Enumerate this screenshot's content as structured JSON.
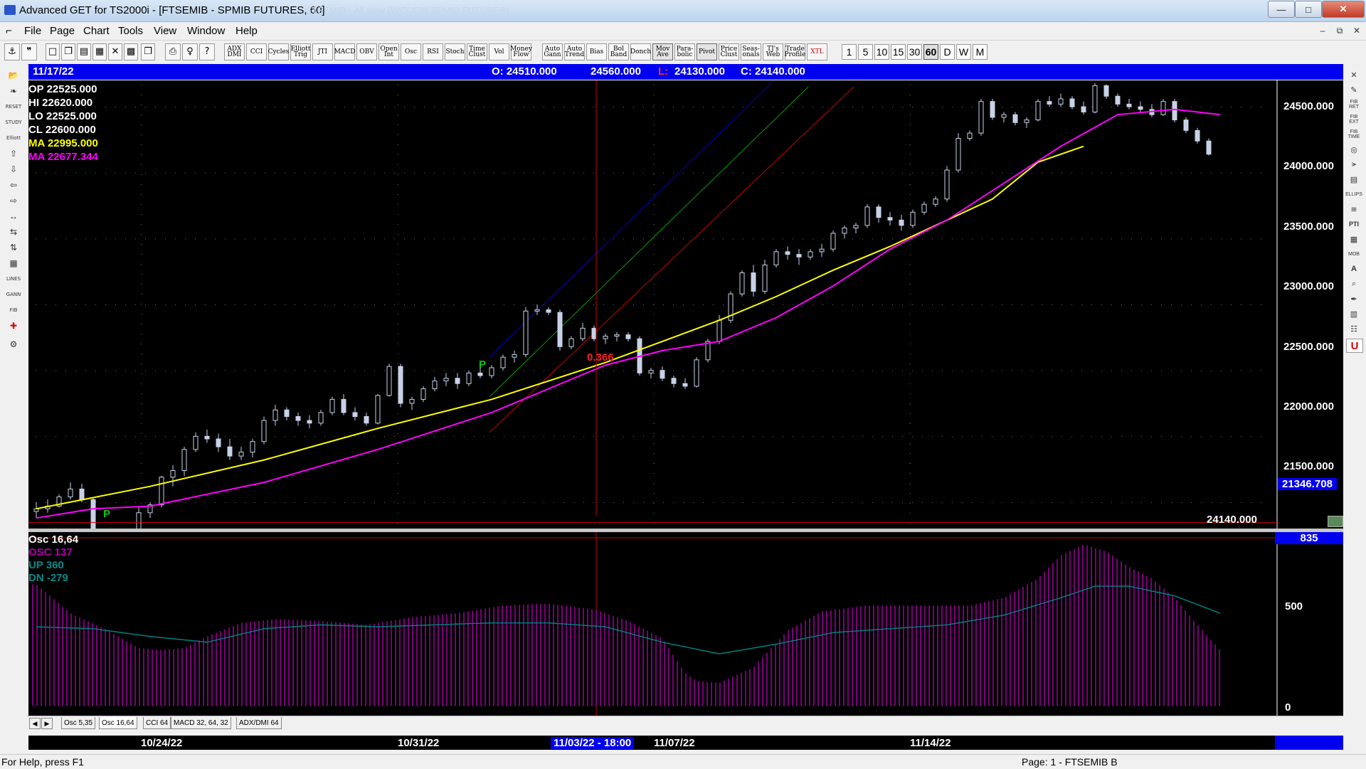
{
  "window": {
    "title": "Advanced GET for TS2000i - [FTSEMIB - SPMIB FUTURES, 60]",
    "ghost_title": "FTSEMIB - All view (WCCCW SPMIB FUTURES)",
    "minimize": "—",
    "maximize": "□",
    "close": "✕"
  },
  "menu": {
    "items": [
      "File",
      "Page",
      "Chart",
      "Tools",
      "View",
      "Window",
      "Help"
    ],
    "mdi_minimize": "–",
    "mdi_restore": "⧉",
    "mdi_close": "✕"
  },
  "toolbar": {
    "icons": [
      "thumbtack-icon",
      "quote-icon",
      "new-page-icon",
      "copy-page-icon",
      "layout-icon",
      "tile-icon",
      "zoom-icon",
      "grid-icon",
      "export-icon",
      "print-icon",
      "help-icon",
      "context-help-icon"
    ],
    "study_buttons": [
      "ADX DMI",
      "CCI",
      "Cycles",
      "Elliott Trig",
      "JTI",
      "MACD",
      "OBV",
      "Open Int",
      "Osc",
      "RSI",
      "Stoch",
      "Time Clust",
      "Vol",
      "Money Flow",
      "Auto Gann",
      "Auto Trend",
      "Bias",
      "Bol Band",
      "Donch",
      "Mov Ave",
      "Para- bolic",
      "Pivot",
      "Price Clust",
      "Seas- onals",
      "TJ's Web",
      "Trade Profile",
      "XTL"
    ],
    "timeframes": [
      "1",
      "5",
      "10",
      "15",
      "30",
      "60",
      "D",
      "W",
      "M"
    ],
    "selected_timeframe": "60"
  },
  "left_tools": [
    "open-icon",
    "pattern-icon",
    "reset",
    "study",
    "elliott",
    "arrow-up-icon",
    "arrow-down-icon",
    "arrow-left-icon",
    "arrow-right-icon",
    "zoom-h-icon",
    "scroll-h-icon",
    "scroll-v-icon",
    "grid",
    "lines",
    "gann",
    "fib",
    "crosshair-icon",
    "settings-icon"
  ],
  "left_tool_labels": {
    "reset": "RESET",
    "study": "STUDY",
    "elliott": "Elliott",
    "lines": "LINES",
    "gann": "GANN",
    "fib": "FIB"
  },
  "right_tools": [
    "close-icon",
    "pencil-icon",
    "fib-ret",
    "fib-ext",
    "fib-time",
    "circle-icon",
    "fan-icon",
    "box-icon",
    "ellipse",
    "wave-icon",
    "pti",
    "grid-icon",
    "mob",
    "text-icon",
    "magnify-icon",
    "marker-icon",
    "table-icon",
    "notes-icon",
    "u-icon"
  ],
  "right_tool_labels": {
    "fib-ret": "FIB RET",
    "fib-ext": "FIB EXT",
    "fib-time": "FIB TIME",
    "ellipse": "ELLIPS",
    "pti": "PTI",
    "mob": "MOB"
  },
  "info_bar": {
    "date": "11/17/22",
    "open": "O: 24510.000",
    "high": "24560.000",
    "low_prefix": "L:",
    "low": "24130.000",
    "close": "C: 24140.000"
  },
  "price_legend": {
    "op": "OP  22525.000",
    "hi": "HI   22620.000",
    "lo": "LO  22525.000",
    "cl": "CL  22600.000",
    "ma1": "MA  22995.000",
    "ma2": "MA  22677.344"
  },
  "price_axis": {
    "ticks": [
      "24500.000",
      "24000.000",
      "23500.000",
      "23000.000",
      "22500.000",
      "22000.000",
      "21500.000"
    ],
    "cursor_price": "21346.708",
    "last_price": "24140.000"
  },
  "annotations": {
    "pivot_label": "P",
    "pivot_value": "0.366"
  },
  "osc_legend": {
    "title": "Osc 16,64",
    "osc": "OSC 137",
    "up": "UP   360",
    "dn": "DN   -279"
  },
  "osc_axis": {
    "ticks": [
      "500",
      "0"
    ],
    "top_value": "835"
  },
  "tabs": [
    "Osc 5,35",
    "Osc 16,64",
    "CCI 64",
    "MACD 32, 64, 32",
    "ADX/DMI 64"
  ],
  "active_tab": "Osc 16,64",
  "dates": {
    "labels": [
      "10/24/22",
      "10/31/22",
      "11/07/22",
      "11/14/22"
    ],
    "cursor": "11/03/22 - 18:00"
  },
  "status": {
    "help": "For Help, press F1",
    "page": "Page: 1 - FTSEMIB B"
  },
  "colors": {
    "background": "#000000",
    "candle": "#c8d2e6",
    "ma_fast": "#ffff00",
    "ma_slow": "#ff00ff",
    "channel_blue": "#0000cc",
    "channel_green": "#00a000",
    "channel_red": "#cc0000",
    "osc_bars": "#cc00cc",
    "osc_line": "#008080",
    "info_bar": "#0000ee"
  },
  "chart_data": {
    "type": "candlestick",
    "symbol": "FTSEMIB - SPMIB FUTURES",
    "interval": "60",
    "ylim": [
      21300,
      24700
    ],
    "grid": true,
    "candles": [
      [
        21430,
        21500,
        21380,
        21450
      ],
      [
        21450,
        21520,
        21420,
        21470
      ],
      [
        21470,
        21560,
        21460,
        21540
      ],
      [
        21540,
        21650,
        21520,
        21600
      ],
      [
        21600,
        21640,
        21500,
        21520
      ],
      [
        21520,
        21530,
        21180,
        21220
      ],
      [
        21220,
        21280,
        21150,
        21240
      ],
      [
        21240,
        21300,
        21180,
        21220
      ],
      [
        21220,
        21260,
        21120,
        21160
      ],
      [
        21160,
        21460,
        21140,
        21420
      ],
      [
        21420,
        21500,
        21380,
        21480
      ],
      [
        21480,
        21700,
        21460,
        21690
      ],
      [
        21690,
        21780,
        21620,
        21740
      ],
      [
        21740,
        21920,
        21700,
        21900
      ],
      [
        21900,
        22030,
        21880,
        22000
      ],
      [
        22000,
        22050,
        21950,
        21980
      ],
      [
        21980,
        22020,
        21880,
        21920
      ],
      [
        21920,
        21980,
        21820,
        21850
      ],
      [
        21850,
        21920,
        21820,
        21880
      ],
      [
        21880,
        21980,
        21840,
        21960
      ],
      [
        21960,
        22150,
        21940,
        22120
      ],
      [
        22120,
        22240,
        22080,
        22200
      ],
      [
        22200,
        22220,
        22120,
        22150
      ],
      [
        22150,
        22180,
        22080,
        22120
      ],
      [
        22120,
        22160,
        22060,
        22100
      ],
      [
        22100,
        22200,
        22080,
        22180
      ],
      [
        22180,
        22300,
        22160,
        22280
      ],
      [
        22280,
        22320,
        22160,
        22180
      ],
      [
        22180,
        22220,
        22120,
        22150
      ],
      [
        22150,
        22180,
        22080,
        22100
      ],
      [
        22100,
        22320,
        22090,
        22310
      ],
      [
        22310,
        22550,
        22300,
        22530
      ],
      [
        22530,
        22550,
        22220,
        22250
      ],
      [
        22250,
        22300,
        22200,
        22280
      ],
      [
        22280,
        22380,
        22260,
        22360
      ],
      [
        22360,
        22450,
        22340,
        22420
      ],
      [
        22420,
        22480,
        22380,
        22440
      ],
      [
        22440,
        22480,
        22360,
        22400
      ],
      [
        22400,
        22500,
        22380,
        22480
      ],
      [
        22480,
        22520,
        22440,
        22460
      ],
      [
        22460,
        22540,
        22440,
        22520
      ],
      [
        22520,
        22620,
        22500,
        22600
      ],
      [
        22600,
        22650,
        22560,
        22620
      ],
      [
        22620,
        22980,
        22600,
        22950
      ],
      [
        22950,
        23000,
        22920,
        22960
      ],
      [
        22960,
        22980,
        22920,
        22940
      ],
      [
        22940,
        22960,
        22650,
        22680
      ],
      [
        22680,
        22760,
        22660,
        22740
      ],
      [
        22740,
        22860,
        22720,
        22820
      ],
      [
        22820,
        22840,
        22720,
        22740
      ],
      [
        22740,
        22780,
        22700,
        22760
      ],
      [
        22760,
        22790,
        22720,
        22770
      ],
      [
        22770,
        22790,
        22720,
        22740
      ],
      [
        22740,
        22760,
        22460,
        22480
      ],
      [
        22480,
        22520,
        22440,
        22500
      ],
      [
        22500,
        22530,
        22420,
        22440
      ],
      [
        22440,
        22460,
        22370,
        22400
      ],
      [
        22400,
        22440,
        22360,
        22380
      ],
      [
        22380,
        22600,
        22370,
        22580
      ],
      [
        22580,
        22740,
        22560,
        22720
      ],
      [
        22720,
        22920,
        22700,
        22880
      ],
      [
        22880,
        23100,
        22860,
        23080
      ],
      [
        23080,
        23260,
        23060,
        23240
      ],
      [
        23240,
        23300,
        23060,
        23100
      ],
      [
        23100,
        23340,
        23080,
        23300
      ],
      [
        23300,
        23420,
        23280,
        23400
      ],
      [
        23400,
        23440,
        23340,
        23380
      ],
      [
        23380,
        23420,
        23300,
        23360
      ],
      [
        23360,
        23420,
        23340,
        23400
      ],
      [
        23400,
        23460,
        23360,
        23420
      ],
      [
        23420,
        23560,
        23400,
        23540
      ],
      [
        23540,
        23600,
        23500,
        23580
      ],
      [
        23580,
        23620,
        23540,
        23600
      ],
      [
        23600,
        23760,
        23580,
        23740
      ],
      [
        23740,
        23760,
        23620,
        23660
      ],
      [
        23660,
        23700,
        23600,
        23640
      ],
      [
        23640,
        23680,
        23560,
        23600
      ],
      [
        23600,
        23720,
        23580,
        23700
      ],
      [
        23700,
        23780,
        23680,
        23760
      ],
      [
        23760,
        23820,
        23740,
        23800
      ],
      [
        23800,
        24050,
        23780,
        24020
      ],
      [
        24020,
        24300,
        24000,
        24260
      ],
      [
        24260,
        24320,
        24240,
        24300
      ],
      [
        24300,
        24560,
        24280,
        24540
      ],
      [
        24540,
        24560,
        24400,
        24420
      ],
      [
        24420,
        24460,
        24380,
        24440
      ],
      [
        24440,
        24460,
        24360,
        24380
      ],
      [
        24380,
        24420,
        24340,
        24400
      ],
      [
        24400,
        24560,
        24390,
        24540
      ],
      [
        24540,
        24580,
        24500,
        24520
      ],
      [
        24520,
        24600,
        24500,
        24560
      ],
      [
        24560,
        24580,
        24480,
        24500
      ],
      [
        24500,
        24540,
        24440,
        24460
      ],
      [
        24460,
        24680,
        24450,
        24660
      ],
      [
        24660,
        24670,
        24560,
        24580
      ],
      [
        24580,
        24600,
        24500,
        24520
      ],
      [
        24520,
        24560,
        24480,
        24500
      ],
      [
        24500,
        24540,
        24460,
        24480
      ],
      [
        24480,
        24520,
        24420,
        24440
      ],
      [
        24440,
        24560,
        24430,
        24540
      ],
      [
        24540,
        24560,
        24380,
        24400
      ],
      [
        24400,
        24420,
        24300,
        24320
      ],
      [
        24320,
        24340,
        24220,
        24240
      ],
      [
        24240,
        24260,
        24130,
        24140
      ]
    ],
    "ma_fast": [
      [
        0,
        21450
      ],
      [
        10,
        21620
      ],
      [
        20,
        21820
      ],
      [
        30,
        22060
      ],
      [
        40,
        22280
      ],
      [
        50,
        22560
      ],
      [
        55,
        22720
      ],
      [
        60,
        22880
      ],
      [
        65,
        23060
      ],
      [
        70,
        23260
      ],
      [
        75,
        23440
      ],
      [
        80,
        23640
      ],
      [
        84,
        23800
      ],
      [
        88,
        24080
      ],
      [
        92,
        24200
      ]
    ],
    "ma_slow": [
      [
        0,
        21380
      ],
      [
        5,
        21450
      ],
      [
        10,
        21470
      ],
      [
        20,
        21650
      ],
      [
        30,
        21900
      ],
      [
        40,
        22180
      ],
      [
        50,
        22540
      ],
      [
        55,
        22650
      ],
      [
        60,
        22720
      ],
      [
        65,
        22900
      ],
      [
        70,
        23140
      ],
      [
        75,
        23420
      ],
      [
        80,
        23640
      ],
      [
        85,
        23920
      ],
      [
        90,
        24200
      ],
      [
        95,
        24440
      ],
      [
        100,
        24480
      ],
      [
        104,
        24440
      ]
    ],
    "oscillator": {
      "name": "Osc 16,64",
      "ylim": [
        -50,
        900
      ],
      "histogram": [
        [
          0,
          630
        ],
        [
          3,
          480
        ],
        [
          6,
          400
        ],
        [
          9,
          300
        ],
        [
          11,
          290
        ],
        [
          13,
          300
        ],
        [
          15,
          360
        ],
        [
          18,
          430
        ],
        [
          21,
          450
        ],
        [
          25,
          440
        ],
        [
          29,
          420
        ],
        [
          33,
          460
        ],
        [
          37,
          480
        ],
        [
          41,
          520
        ],
        [
          45,
          530
        ],
        [
          49,
          500
        ],
        [
          52,
          440
        ],
        [
          55,
          350
        ],
        [
          57,
          170
        ],
        [
          58,
          130
        ],
        [
          60,
          120
        ],
        [
          63,
          200
        ],
        [
          66,
          390
        ],
        [
          69,
          490
        ],
        [
          73,
          520
        ],
        [
          78,
          520
        ],
        [
          82,
          520
        ],
        [
          85,
          560
        ],
        [
          88,
          660
        ],
        [
          90,
          780
        ],
        [
          92,
          835
        ],
        [
          94,
          800
        ],
        [
          96,
          720
        ],
        [
          98,
          660
        ],
        [
          100,
          560
        ],
        [
          102,
          420
        ],
        [
          104,
          290
        ]
      ],
      "line": [
        [
          0,
          410
        ],
        [
          5,
          400
        ],
        [
          10,
          360
        ],
        [
          15,
          330
        ],
        [
          20,
          400
        ],
        [
          25,
          420
        ],
        [
          30,
          410
        ],
        [
          35,
          420
        ],
        [
          40,
          430
        ],
        [
          45,
          430
        ],
        [
          50,
          410
        ],
        [
          55,
          330
        ],
        [
          60,
          270
        ],
        [
          65,
          320
        ],
        [
          70,
          380
        ],
        [
          75,
          400
        ],
        [
          80,
          420
        ],
        [
          85,
          470
        ],
        [
          90,
          560
        ],
        [
          93,
          620
        ],
        [
          96,
          620
        ],
        [
          100,
          570
        ],
        [
          104,
          480
        ]
      ]
    }
  }
}
